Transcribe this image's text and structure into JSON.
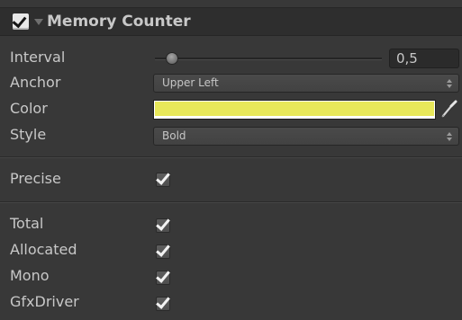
{
  "component": {
    "title": "Memory Counter",
    "enabled": true
  },
  "fields": {
    "interval": {
      "label": "Interval",
      "value": "0,5",
      "slider_fraction": 0.05
    },
    "anchor": {
      "label": "Anchor",
      "value": "Upper Left"
    },
    "color": {
      "label": "Color",
      "value": "#e8e85a"
    },
    "style": {
      "label": "Style",
      "value": "Bold"
    },
    "precise": {
      "label": "Precise",
      "checked": true
    },
    "total": {
      "label": "Total",
      "checked": true
    },
    "allocated": {
      "label": "Allocated",
      "checked": true
    },
    "mono": {
      "label": "Mono",
      "checked": true
    },
    "gfx_driver": {
      "label": "GfxDriver",
      "checked": true
    }
  },
  "icons": {
    "foldout": "triangle-down-icon",
    "eyedropper": "eyedropper-icon",
    "dropdown": "updown-arrows-icon"
  },
  "colors": {
    "panel_bg": "#383838",
    "header_bg": "#2e2e2e",
    "text": "#c8c8c8",
    "swatch": "#e8e85a"
  }
}
